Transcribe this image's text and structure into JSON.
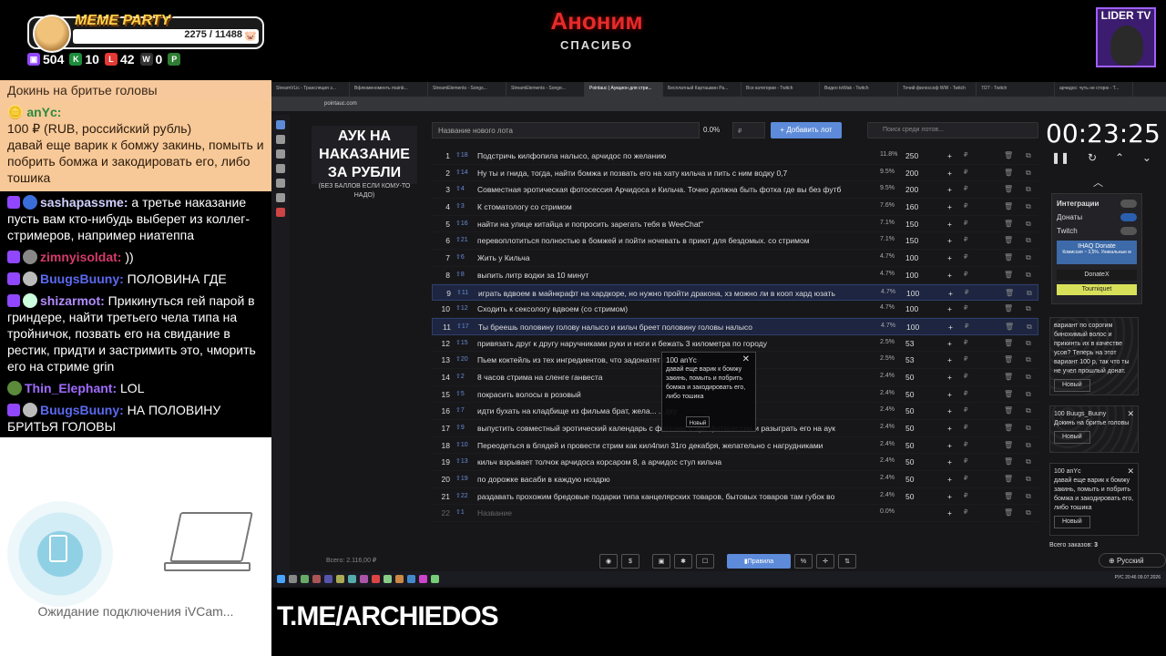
{
  "overlay": {
    "meme_party": {
      "title": "MEME PARTY",
      "progress": "2275 / 11488",
      "pig_icon": "pig-icon"
    },
    "stats": [
      {
        "icon": "twitch-icon",
        "color": "#9147ff",
        "value": "504"
      },
      {
        "icon": "kick-icon",
        "color": "#53fc18",
        "value": "10"
      },
      {
        "icon": "live-icon",
        "color": "#e53935",
        "value": "42"
      },
      {
        "icon": "w-icon",
        "color": "#555555",
        "value": "0"
      },
      {
        "icon": "p-icon",
        "color": "#53fc18",
        "value": ""
      }
    ],
    "anon_title": "Аноним",
    "anon_sub": "СПАСИБО",
    "lider_label": "LIDER TV",
    "tme": "T.ME/ARCHIEDOS",
    "ivcam_status": "Ожидание подключения iVCam..."
  },
  "chat": {
    "top_line": "Докинь на бритье головы",
    "donation": {
      "user": "anYc:",
      "amount": "100 ₽ (RUB, российский рубль)",
      "text": "давай еще варик к бомжу закинь, помыть и побрить бомжа и закодировать его, либо тошика"
    },
    "messages": [
      {
        "user": "sashapassme:",
        "color": "#d0d0ff",
        "text": " а третье наказание пусть вам кто-нибудь выберет из коллег-стримеров, например ниатеппа"
      },
      {
        "user": "zimnyisoldat:",
        "color": "#d43b6a",
        "text": " ))"
      },
      {
        "user": "BuugsBuuny:",
        "color": "#5a6af0",
        "text": " ПОЛОВИНА ГДЕ"
      },
      {
        "user": "shizarmot:",
        "color": "#b38cff",
        "text": " Прикинуться гей парой в гриндере, найти третьего чела типа на тройничок, позвать его на свидание в рестик, придти и застримить это, чморить его на стриме grin"
      },
      {
        "user": "Thin_Elephant:",
        "color": "#a06cff",
        "text": " LOL"
      },
      {
        "user": "BuugsBuuny:",
        "color": "#5a6af0",
        "text": " НА ПОЛОВИНУ БРИТЬЯ ГОЛОВЫ"
      }
    ]
  },
  "browser": {
    "tabs": [
      "StreamVLic - Трансляция э...",
      "Вфлюменоменть mainb...",
      "StreamElements - Songs...",
      "StreamElements - Songe...",
      "Pointauc | Аукцион для стри...",
      "Бесплатный Карташкин Ра...",
      "Все категории - Twitch",
      "Видео toWak - Twitch",
      "Точий филоссоф WW - Twitch",
      "7/27 - Twitch",
      "арчидос: чуть не сторю - Т..."
    ],
    "url": "pointauc.com",
    "auction_title": "АУК НА НАКАЗАНИЕ ЗА РУБЛИ",
    "auction_sub": "(БЕЗ БАЛЛОВ ЕСЛИ КОМУ-ТО НАДО)",
    "lot_placeholder": "Название нового лота",
    "pct": "0.0%",
    "rub_placeholder": "₽",
    "add_label": "Добавить лот",
    "search_placeholder": "Поиск среди лотов...",
    "lots": [
      {
        "n": "1",
        "rank": "18",
        "name": "Подстричь килфопила налысо, арчидос по желанию",
        "pct": "11.8%",
        "amt": "250"
      },
      {
        "n": "2",
        "rank": "14",
        "name": "Ну ты и гнида, тогда, найти бомжа и позвать его на хату кильча и пить с ним водку 0,7",
        "pct": "9.5%",
        "amt": "200"
      },
      {
        "n": "3",
        "rank": "4",
        "name": "Совместная эротическая фотосессия Арчидоса и Кильча. Точно должна быть фотка где вы без футб",
        "pct": "9.5%",
        "amt": "200"
      },
      {
        "n": "4",
        "rank": "3",
        "name": "К стоматологу со стримом",
        "pct": "7.6%",
        "amt": "160"
      },
      {
        "n": "5",
        "rank": "16",
        "name": "найти на улице китайца и попросить зарегать тебя в WeeChat\"",
        "pct": "7.1%",
        "amt": "150"
      },
      {
        "n": "6",
        "rank": "21",
        "name": "перевоплотиться полностью в бомжей и пойти ночевать в приют для бездомых. со стримом",
        "pct": "7.1%",
        "amt": "150"
      },
      {
        "n": "7",
        "rank": "6",
        "name": "Жить у Кильча",
        "pct": "4.7%",
        "amt": "100"
      },
      {
        "n": "8",
        "rank": "8",
        "name": "выпить литр водки за 10 минут",
        "pct": "4.7%",
        "amt": "100"
      },
      {
        "n": "9",
        "rank": "11",
        "name": "играть вдвоем в майнкрафт на хардкоре, но нужно пройти дракона, хз можно ли в кооп хард юзать",
        "pct": "4.7%",
        "amt": "100"
      },
      {
        "n": "10",
        "rank": "12",
        "name": "Сходить к сексологу вдвоем (со стримом)",
        "pct": "4.7%",
        "amt": "100"
      },
      {
        "n": "11",
        "rank": "17",
        "name": "Ты бреешь половину голову налысо и кильч бреет половину головы налысо",
        "pct": "4.7%",
        "amt": "100"
      },
      {
        "n": "12",
        "rank": "15",
        "name": "привязать друг к другу наручниками руки и ноги и бежать 3 километра по городу",
        "pct": "2.5%",
        "amt": "53"
      },
      {
        "n": "13",
        "rank": "20",
        "name": "Пьем коктейль из тех ингредиентов, что задонатят по стакану",
        "pct": "2.5%",
        "amt": "53"
      },
      {
        "n": "14",
        "rank": "2",
        "name": "8 часов стрима на сленге ганвеста",
        "pct": "2.4%",
        "amt": "50"
      },
      {
        "n": "15",
        "rank": "5",
        "name": "покрасить волосы в розовый",
        "pct": "2.4%",
        "amt": "50"
      },
      {
        "n": "16",
        "rank": "7",
        "name": "идти бухать на кладбище из фильма брат, жела... ...дку",
        "pct": "2.4%",
        "amt": "50"
      },
      {
        "n": "17",
        "rank": "9",
        "name": "выпустить совместный эротический календарь с фотками с эро фотосессии и разыграть его на аук",
        "pct": "2.4%",
        "amt": "50"
      },
      {
        "n": "18",
        "rank": "10",
        "name": "Переодеться в блядей и провести стрим как кил4пил 31го декабря, желательно с нагрудниками",
        "pct": "2.4%",
        "amt": "50"
      },
      {
        "n": "19",
        "rank": "13",
        "name": "кильч взрывает толчок арчидоса корсаром 8, а арчидос стул кильча",
        "pct": "2.4%",
        "amt": "50"
      },
      {
        "n": "20",
        "rank": "19",
        "name": "по дорожке васаби в каждую ноздрю",
        "pct": "2.4%",
        "amt": "50"
      },
      {
        "n": "21",
        "rank": "22",
        "name": "раздавать прохожим бредовые подарки типа канцелярских товаров, бытовых товаров там губок во",
        "pct": "2.4%",
        "amt": "50"
      },
      {
        "n": "22",
        "rank": "1",
        "name": "Название",
        "pct": "0.0%",
        "amt": ""
      }
    ],
    "popup": {
      "header": "100 anYc",
      "text": "давай еще варик к бомжу закинь, помыть и побрить бомжа и закодировать его, либо тошика",
      "button": "Новый"
    },
    "total": "Всего: 2.116,00 ₽",
    "tools": [
      "github-icon",
      "$",
      "a",
      "b",
      "c"
    ],
    "rules_label": "Правила",
    "timer": "00:23:25",
    "integrations": {
      "title": "Интеграции",
      "donations": "Донаты",
      "twitch": "Twitch",
      "donate_card": "IHAQ Donate",
      "donate_card_sub": "Комиссия ~ 3,5%. Уникальные м",
      "donatex": "DonateX",
      "tourniquet": "Tourniquet"
    },
    "side_cards": [
      {
        "text": "вариант по сорогим бинохимый волос и прикинть их в качестве усов? Теперь на этот вариант 100 р, так что ты не учел прошлый донат.",
        "btn": "Новый"
      },
      {
        "header": "100 Buugs_Buuny",
        "text": "Докинь на бритье головы",
        "btn": "Новый"
      },
      {
        "header": "100 anYc",
        "text": "давай еще варик к бомжу закинь, помыть и побрить бомжа и закодировать его, либо тошика",
        "btn": "Новый"
      }
    ],
    "orders": "Всего заказов:",
    "orders_count": "3",
    "lang": "Русский"
  },
  "taskbar": {
    "time": "20:46",
    "date": "09.07.2026",
    "lang": "РУС"
  }
}
